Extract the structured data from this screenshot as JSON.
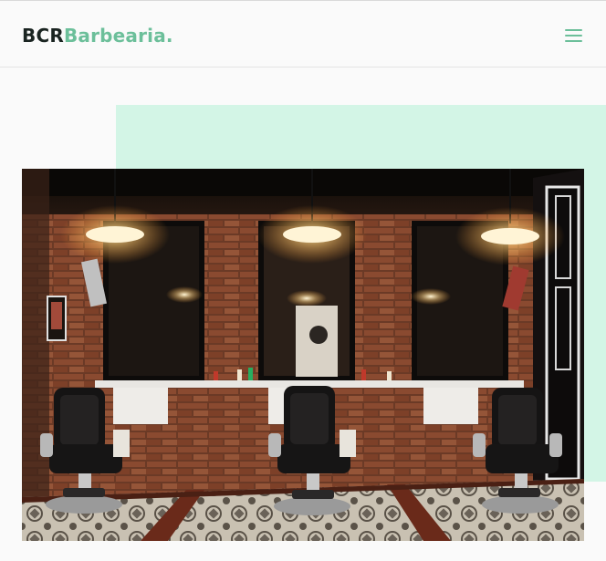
{
  "header": {
    "logo": {
      "part1": "BCR",
      "part2": "Barbearia."
    },
    "menu_icon": "hamburger-menu-icon"
  },
  "hero": {
    "photo_subject": "barbershop-interior-photo"
  },
  "colors": {
    "brand_dark": "#1a2421",
    "brand_green": "#6cbf9a",
    "accent_mint": "#d3f5e6",
    "background": "#fafafa"
  }
}
